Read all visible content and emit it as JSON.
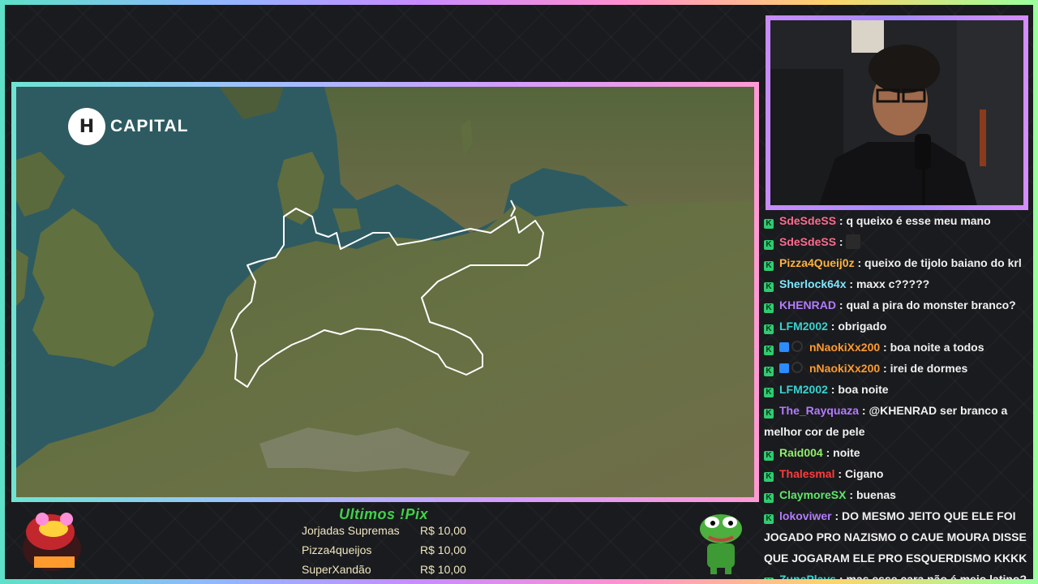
{
  "map": {
    "logo_badge": "H",
    "logo_text": "CAPITAL"
  },
  "chat": [
    {
      "user": "SdeSdeSS",
      "color": "#ff6b8f",
      "text": "q queixo é esse meu mano",
      "cube": false
    },
    {
      "user": "SdeSdeSS",
      "color": "#ff6b8f",
      "text": "",
      "emote": true,
      "cube": false
    },
    {
      "user": "Pizza4Queij0z",
      "color": "#ffb23e",
      "text": "queixo de tijolo baiano do krl",
      "cube": false
    },
    {
      "user": "Sherlock64x",
      "color": "#7fe7ff",
      "text": "maxx c?????",
      "cube": false
    },
    {
      "user": "KHENRAD",
      "color": "#b47bff",
      "text": "qual a pira do monster branco?",
      "cube": false
    },
    {
      "user": "LFM2002",
      "color": "#38d3d0",
      "text": "obrigado",
      "cube": false
    },
    {
      "user": "nNaokiXx200",
      "color": "#ff9a2e",
      "text": "boa noite a todos",
      "cube": true
    },
    {
      "user": "nNaokiXx200",
      "color": "#ff9a2e",
      "text": "irei de dormes",
      "cube": true
    },
    {
      "user": "LFM2002",
      "color": "#38d3d0",
      "text": "boa noite",
      "cube": false
    },
    {
      "user": "The_Rayquaza",
      "color": "#b47bff",
      "text": "@KHENRAD ser branco a melhor cor de pele",
      "cube": false
    },
    {
      "user": "Raid004",
      "color": "#8ff06b",
      "text": "noite",
      "cube": false
    },
    {
      "user": "Thalesmal",
      "color": "#ff3b3b",
      "text": "Cigano",
      "cube": false
    },
    {
      "user": "ClaymoreSX",
      "color": "#5ee86a",
      "text": "buenas",
      "cube": false
    },
    {
      "user": "lokoviwer",
      "color": "#b47bff",
      "text": "DO MESMO JEITO QUE ELE FOI JOGADO PRO NAZISMO O CAUE MOURA DISSE QUE JOGARAM ELE PRO ESQUERDISMO KKKK",
      "cube": false
    },
    {
      "user": "ZunePlays",
      "color": "#38d3d0",
      "text": "mas esse cara não é meio latino?",
      "cube": false
    }
  ],
  "pix": {
    "title": "Ultimos !Pix",
    "entries": [
      {
        "name": "Jorjadas Supremas",
        "value": "R$ 10,00"
      },
      {
        "name": "Pizza4queijos",
        "value": "R$ 10,00"
      },
      {
        "name": "SuperXandão",
        "value": "R$ 10,00"
      }
    ]
  }
}
